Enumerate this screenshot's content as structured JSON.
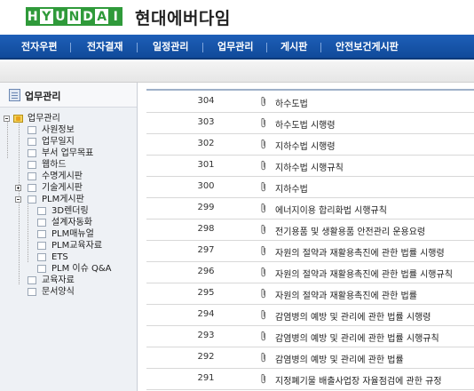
{
  "header": {
    "logo_letters": [
      "H",
      "Y",
      "U",
      "N",
      "D",
      "A",
      "I"
    ],
    "brand": "현대에버다임"
  },
  "nav": {
    "items": [
      "전자우편",
      "전자결재",
      "일정관리",
      "업무관리",
      "게시판",
      "안전보건게시판"
    ]
  },
  "sidebar": {
    "title": "업무관리",
    "tree": [
      {
        "label": "업무관리"
      },
      {
        "label": "사원정보"
      },
      {
        "label": "업무일지"
      },
      {
        "label": "부서 업무목표"
      },
      {
        "label": "웹하드"
      },
      {
        "label": "수명게시판"
      },
      {
        "label": "기술게시판"
      },
      {
        "label": "PLM게시판"
      },
      {
        "label": "3D렌더링"
      },
      {
        "label": "설계자동화"
      },
      {
        "label": "PLM매뉴얼"
      },
      {
        "label": "PLM교육자료"
      },
      {
        "label": "ETS"
      },
      {
        "label": "PLM 이슈 Q&A"
      },
      {
        "label": "교육자료"
      },
      {
        "label": "문서양식"
      }
    ]
  },
  "list": {
    "rows": [
      {
        "num": "304",
        "title": "하수도법"
      },
      {
        "num": "303",
        "title": "하수도법 시행령"
      },
      {
        "num": "302",
        "title": "지하수법 시행령"
      },
      {
        "num": "301",
        "title": "지하수법 시행규칙"
      },
      {
        "num": "300",
        "title": "지하수법"
      },
      {
        "num": "299",
        "title": "에너지이용 합리화법 시행규칙"
      },
      {
        "num": "298",
        "title": "전기용품 및 생활용품 안전관리 운용요령"
      },
      {
        "num": "297",
        "title": "자원의 절약과 재활용촉진에 관한 법률 시행령"
      },
      {
        "num": "296",
        "title": "자원의 절약과 재활용촉진에 관한 법률 시행규칙"
      },
      {
        "num": "295",
        "title": "자원의 절약과 재활용촉진에 관한 법률"
      },
      {
        "num": "294",
        "title": "감염병의 예방 및 관리에 관한 법률 시행령"
      },
      {
        "num": "293",
        "title": "감염병의 예방 및 관리에 관한 법률 시행규칙"
      },
      {
        "num": "292",
        "title": "감염병의 예방 및 관리에 관한 법률"
      },
      {
        "num": "291",
        "title": "지정폐기물 배출사업장 자율점검에 관한 규정"
      }
    ]
  },
  "colors": {
    "logo_green": "#2f9a3a",
    "nav_blue": "#1856ad",
    "sidebar_bg": "#eef1f5"
  }
}
